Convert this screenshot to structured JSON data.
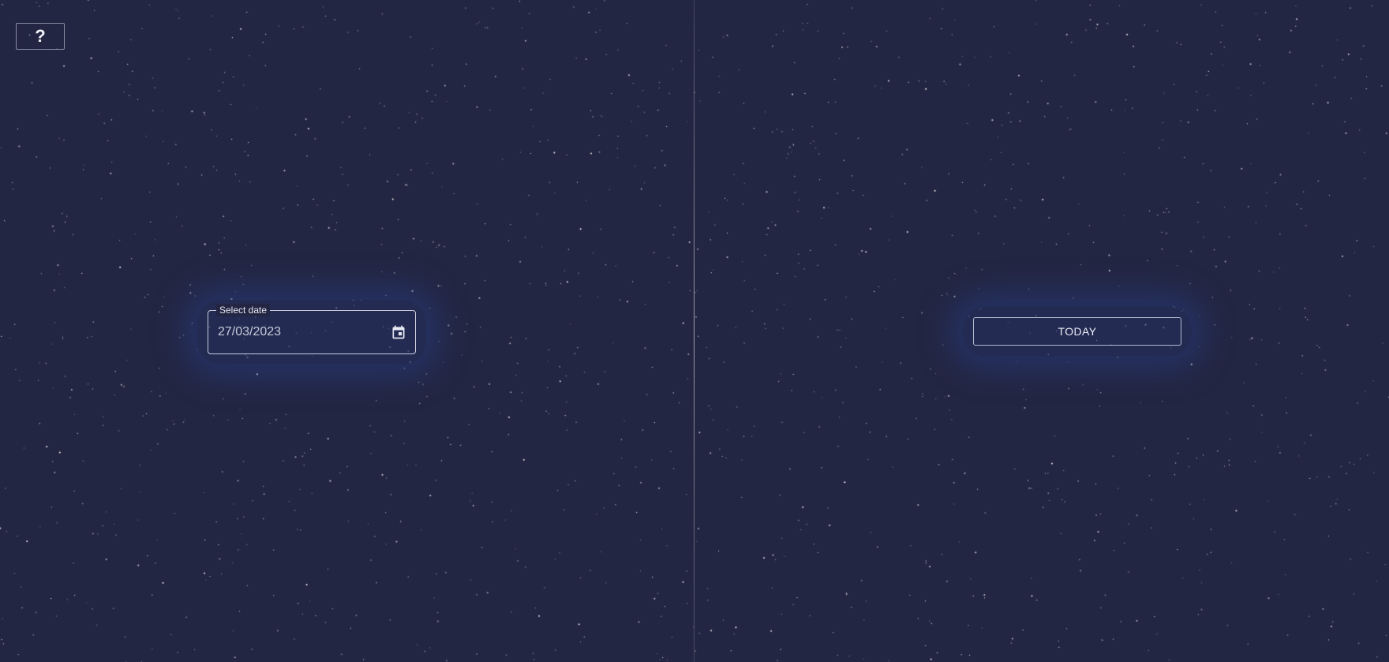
{
  "help": {
    "label": "?"
  },
  "date_picker": {
    "label": "Select date",
    "value": "27/03/2023",
    "icon": "calendar-icon"
  },
  "today_button": {
    "label": "TODAY"
  },
  "colors": {
    "background": "#232642",
    "star": "#ffffff",
    "glow": "#28408c",
    "border": "#e6e8f5"
  }
}
